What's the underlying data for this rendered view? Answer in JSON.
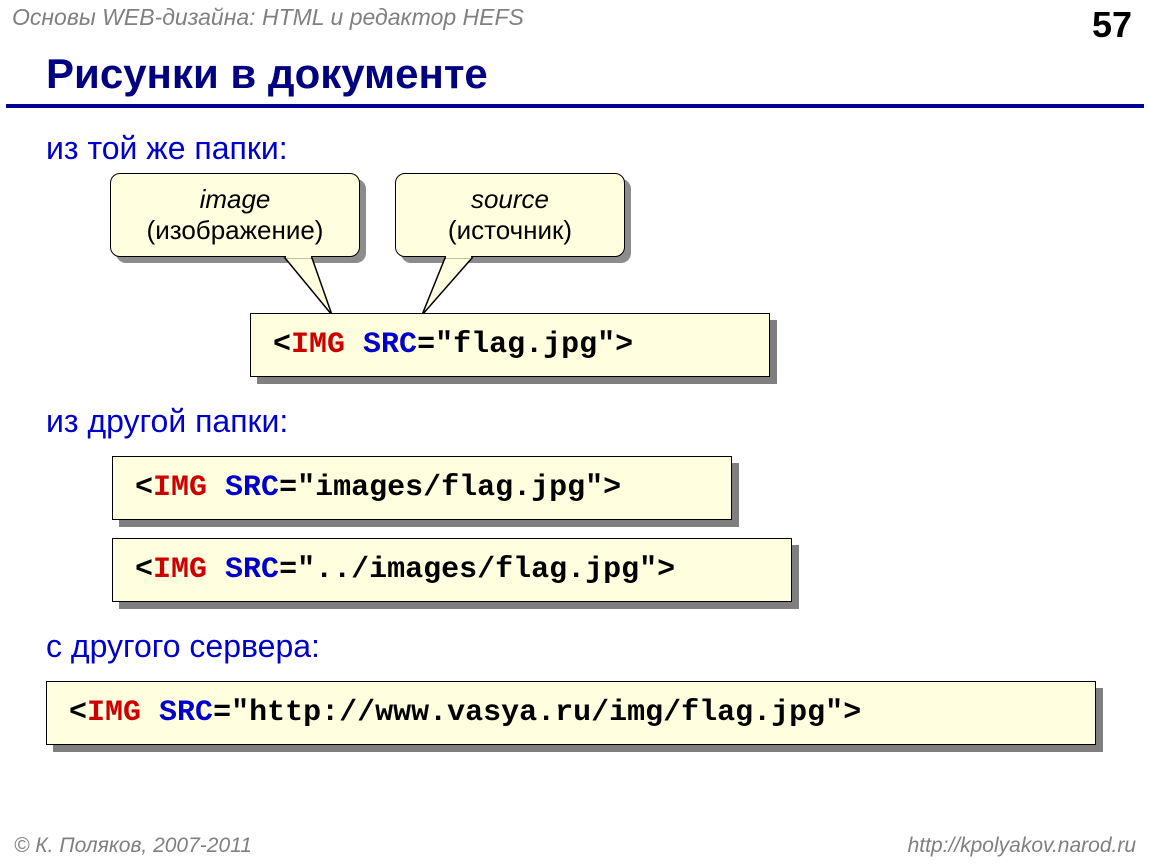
{
  "header": {
    "course_title": "Основы WEB-дизайна: HTML и редактор HEFS",
    "page_number": "57"
  },
  "title": "Рисунки в документе",
  "section1_label": "из той же папки:",
  "section2_label": "из другой папки:",
  "section3_label": "с другого сервера:",
  "callouts": {
    "img": {
      "line1": "image",
      "line2": "(изображение)"
    },
    "src": {
      "line1": "source",
      "line2": "(источник)"
    }
  },
  "code": {
    "lt": "<",
    "gt": ">",
    "tag": "IMG",
    "attr": "SRC",
    "eq": "=",
    "path1": "\"flag.jpg\"",
    "path2": "\"images/flag.jpg\"",
    "path3": "\"../images/flag.jpg\"",
    "path4": "\"http://www.vasya.ru/img/flag.jpg\""
  },
  "footer": {
    "copyright": "© К. Поляков, 2007-2011",
    "url": "http://kpolyakov.narod.ru"
  }
}
